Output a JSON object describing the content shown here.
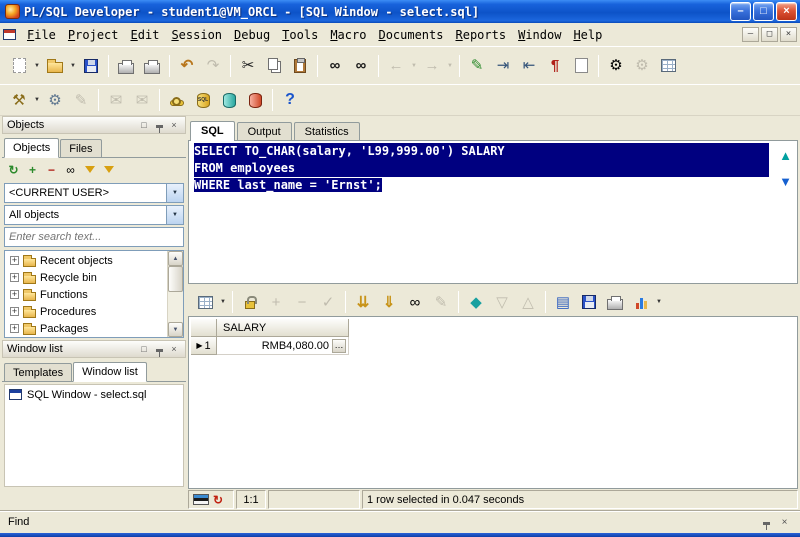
{
  "window": {
    "title": "PL/SQL Developer - student1@VM_ORCL - [SQL Window - select.sql]"
  },
  "menu": {
    "items": [
      "File",
      "Project",
      "Edit",
      "Session",
      "Debug",
      "Tools",
      "Macro",
      "Documents",
      "Reports",
      "Window",
      "Help"
    ]
  },
  "sidebar": {
    "objects": {
      "title": "Objects",
      "tabs": [
        "Objects",
        "Files"
      ],
      "user_filter": "<CURRENT USER>",
      "object_filter": "All objects",
      "search_placeholder": "Enter search text...",
      "tree": [
        "Recent objects",
        "Recycle bin",
        "Functions",
        "Procedures",
        "Packages"
      ]
    },
    "window_list": {
      "title": "Window list",
      "tabs": [
        "Templates",
        "Window list"
      ],
      "items": [
        "SQL Window - select.sql"
      ]
    }
  },
  "main": {
    "tabs": [
      "SQL",
      "Output",
      "Statistics"
    ],
    "editor": {
      "lines": [
        "SELECT TO_CHAR(salary, 'L99,999.00') SALARY",
        "FROM employees",
        "WHERE last_name = 'Ernst';"
      ]
    },
    "grid": {
      "columns": [
        "SALARY"
      ],
      "rows": [
        {
          "num": "1",
          "value": "RMB4,080.00"
        }
      ],
      "ellipsis": "…"
    },
    "status": {
      "position": "1:1",
      "message": "1 row selected in 0.047 seconds"
    }
  },
  "find": {
    "label": "Find"
  },
  "colors": {
    "selection": "#000080",
    "titlebar_blue": "#0d53c8",
    "chrome_beige": "#ece9d8"
  },
  "icons": {
    "dropdown": "▼",
    "undo": "↶",
    "redo": "↷",
    "cut": "✂",
    "find": "∞",
    "find_next": "∞",
    "back": "←",
    "forward": "→",
    "indent": "⇥",
    "unindent": "⇤",
    "beautify": "¶",
    "pencil": "✎",
    "mail": "✉",
    "gear": "⚙",
    "wrench": "⚒",
    "help": "?",
    "refresh": "↻",
    "plus": "+",
    "minus": "−",
    "check": "✓",
    "fetch_next": "⇊",
    "fetch_all": "⇓",
    "sort": "◆",
    "up": "△",
    "down": "▽",
    "nav_up": "▲",
    "nav_down": "▼",
    "expand": "+",
    "row_marker": "▶",
    "single_record": "▤",
    "close": "×",
    "minimize": "–",
    "restore": "□",
    "scroll_up": "▲",
    "scroll_down": "▼"
  }
}
